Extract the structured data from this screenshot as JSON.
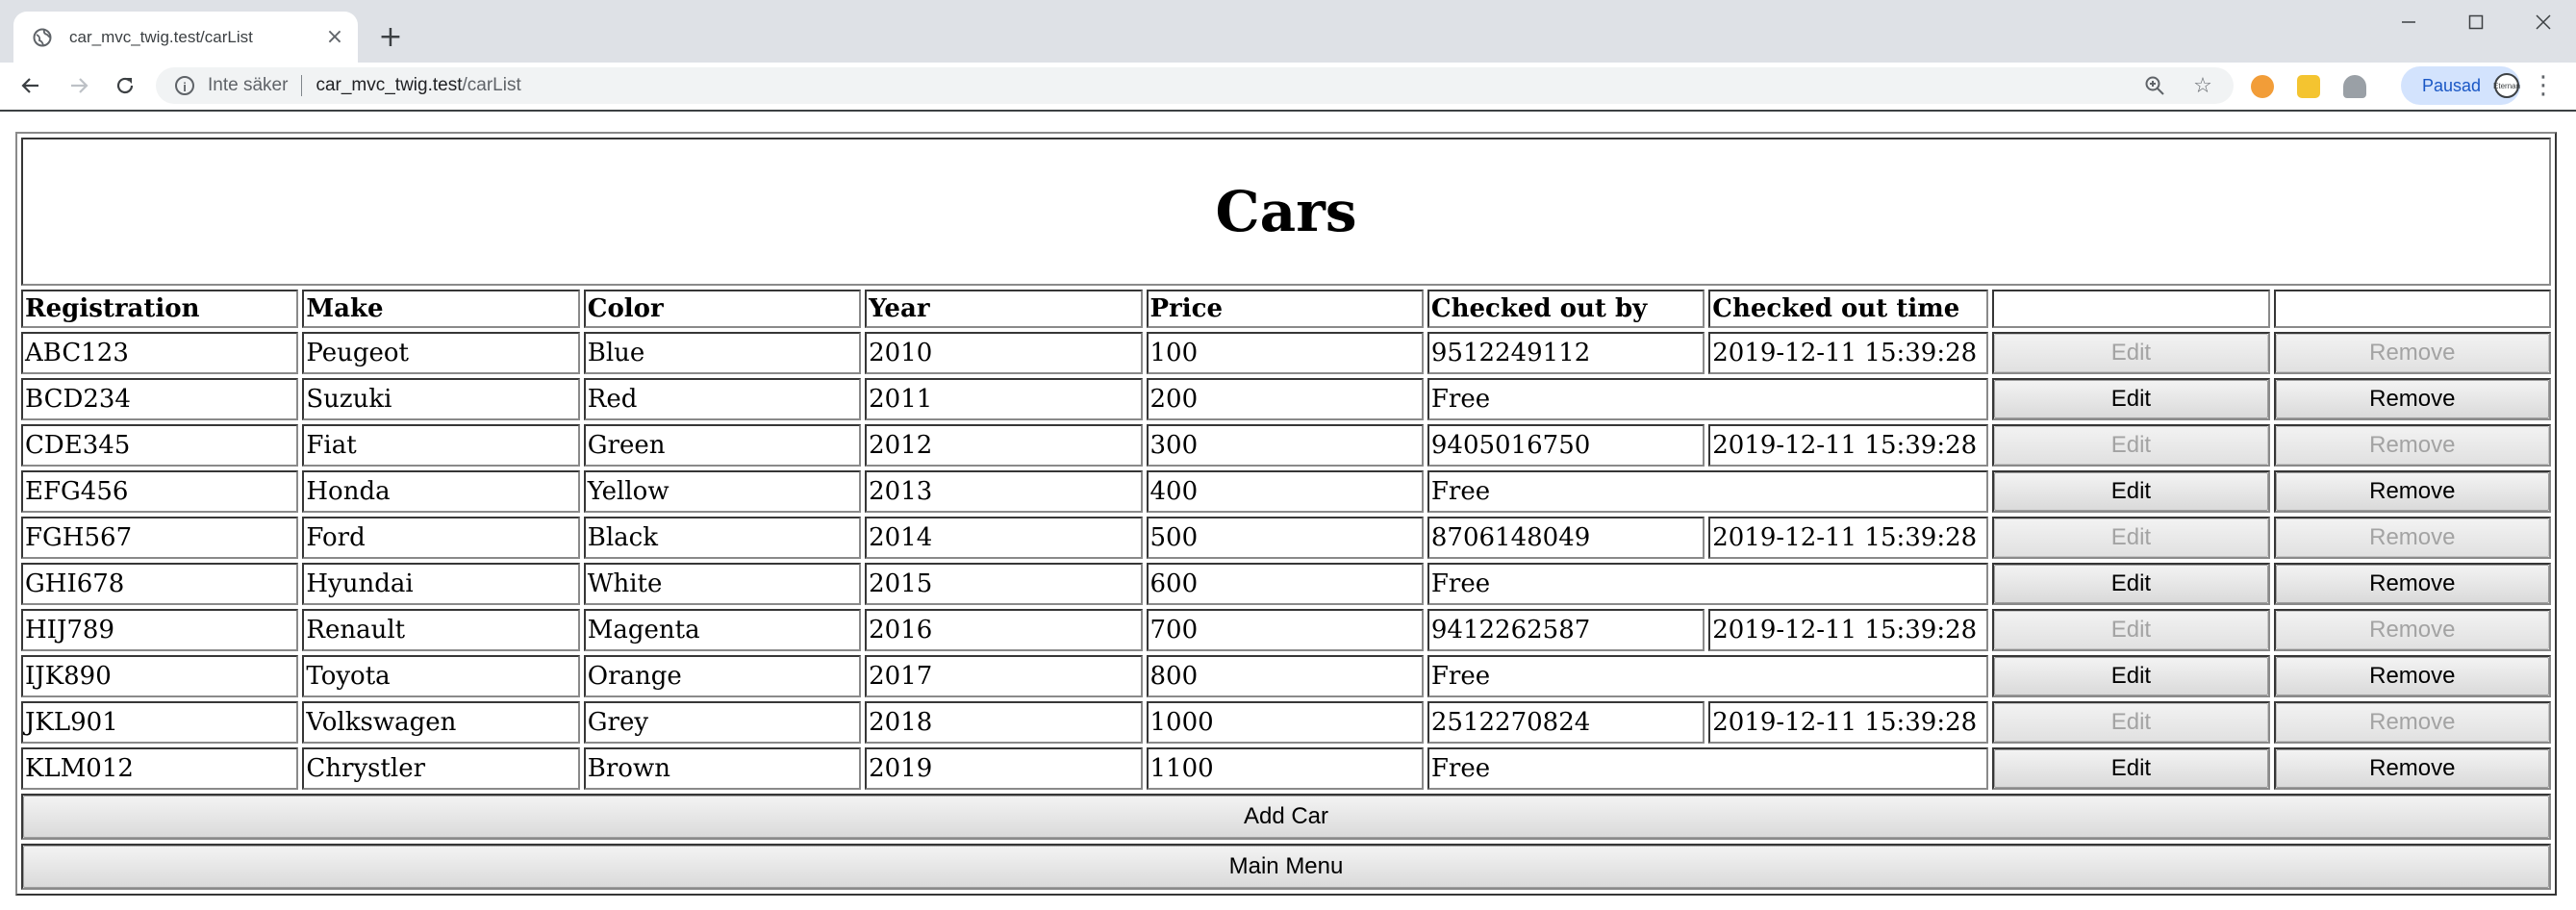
{
  "browser": {
    "tab_title": "car_mvc_twig.test/carList",
    "url_security": "Inte säker",
    "url_host": "car_mvc_twig.test",
    "url_path": "/carList",
    "profile_label": "Pausad",
    "profile_avatar_text": "Eternan",
    "icons": [
      "globe-icon",
      "close-icon",
      "plus-icon",
      "minimize-icon",
      "maximize-icon",
      "window-close-icon",
      "back-icon",
      "forward-icon",
      "reload-icon",
      "info-icon",
      "zoom-icon",
      "star-icon",
      "extension-icon",
      "menu-icon"
    ]
  },
  "page": {
    "title": "Cars",
    "columns": [
      "Registration",
      "Make",
      "Color",
      "Year",
      "Price",
      "Checked out by",
      "Checked out time",
      "",
      ""
    ],
    "edit_label": "Edit",
    "remove_label": "Remove",
    "add_car_label": "Add Car",
    "main_menu_label": "Main Menu",
    "cars": [
      {
        "registration": "ABC123",
        "make": "Peugeot",
        "color": "Blue",
        "year": "2010",
        "price": "100",
        "checked_out_by": "9512249112",
        "checked_out_time": "2019-12-11 15:39:28",
        "checked_out": true
      },
      {
        "registration": "BCD234",
        "make": "Suzuki",
        "color": "Red",
        "year": "2011",
        "price": "200",
        "status": "Free",
        "checked_out": false
      },
      {
        "registration": "CDE345",
        "make": "Fiat",
        "color": "Green",
        "year": "2012",
        "price": "300",
        "checked_out_by": "9405016750",
        "checked_out_time": "2019-12-11 15:39:28",
        "checked_out": true
      },
      {
        "registration": "EFG456",
        "make": "Honda",
        "color": "Yellow",
        "year": "2013",
        "price": "400",
        "status": "Free",
        "checked_out": false
      },
      {
        "registration": "FGH567",
        "make": "Ford",
        "color": "Black",
        "year": "2014",
        "price": "500",
        "checked_out_by": "8706148049",
        "checked_out_time": "2019-12-11 15:39:28",
        "checked_out": true
      },
      {
        "registration": "GHI678",
        "make": "Hyundai",
        "color": "White",
        "year": "2015",
        "price": "600",
        "status": "Free",
        "checked_out": false
      },
      {
        "registration": "HIJ789",
        "make": "Renault",
        "color": "Magenta",
        "year": "2016",
        "price": "700",
        "checked_out_by": "9412262587",
        "checked_out_time": "2019-12-11 15:39:28",
        "checked_out": true
      },
      {
        "registration": "IJK890",
        "make": "Toyota",
        "color": "Orange",
        "year": "2017",
        "price": "800",
        "status": "Free",
        "checked_out": false
      },
      {
        "registration": "JKL901",
        "make": "Volkswagen",
        "color": "Grey",
        "year": "2018",
        "price": "1000",
        "checked_out_by": "2512270824",
        "checked_out_time": "2019-12-11 15:39:28",
        "checked_out": true
      },
      {
        "registration": "KLM012",
        "make": "Chrystler",
        "color": "Brown",
        "year": "2019",
        "price": "1100",
        "status": "Free",
        "checked_out": false
      }
    ]
  }
}
